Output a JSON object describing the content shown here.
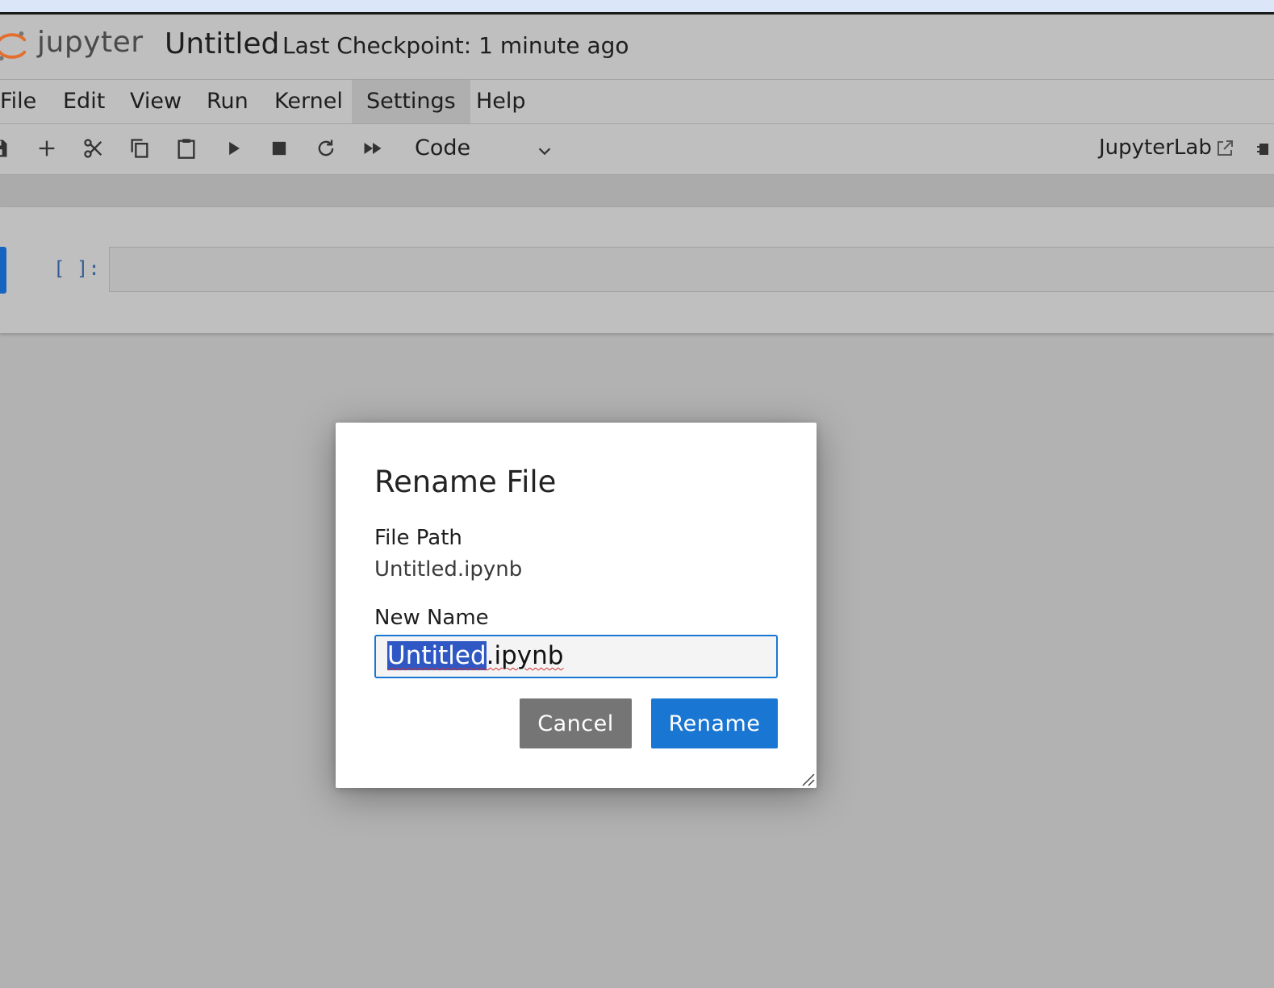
{
  "header": {
    "brand": "jupyter",
    "notebook_title": "Untitled",
    "checkpoint": "Last Checkpoint: 1 minute ago"
  },
  "menu": {
    "items": [
      "File",
      "Edit",
      "View",
      "Run",
      "Kernel",
      "Settings",
      "Help"
    ],
    "active": "Settings"
  },
  "toolbar": {
    "icons": [
      "save-icon",
      "plus-icon",
      "scissors-icon",
      "copy-icon",
      "paste-icon",
      "run-icon",
      "stop-icon",
      "restart-icon",
      "fast-forward-icon"
    ],
    "cell_type": "Code",
    "jupyterlab_link": "JupyterLab"
  },
  "cell": {
    "prompt": "[ ]:"
  },
  "dialog": {
    "title": "Rename File",
    "path_label": "File Path",
    "path_value": "Untitled.ipynb",
    "name_label": "New Name",
    "name_selected": "Untitled",
    "name_rest": ".ipynb",
    "cancel_label": "Cancel",
    "rename_label": "Rename"
  },
  "colors": {
    "accent": "#1976d2",
    "cancel_button": "#757575",
    "selection": "#2f58c4",
    "logo_orange": "#e46e2e"
  }
}
